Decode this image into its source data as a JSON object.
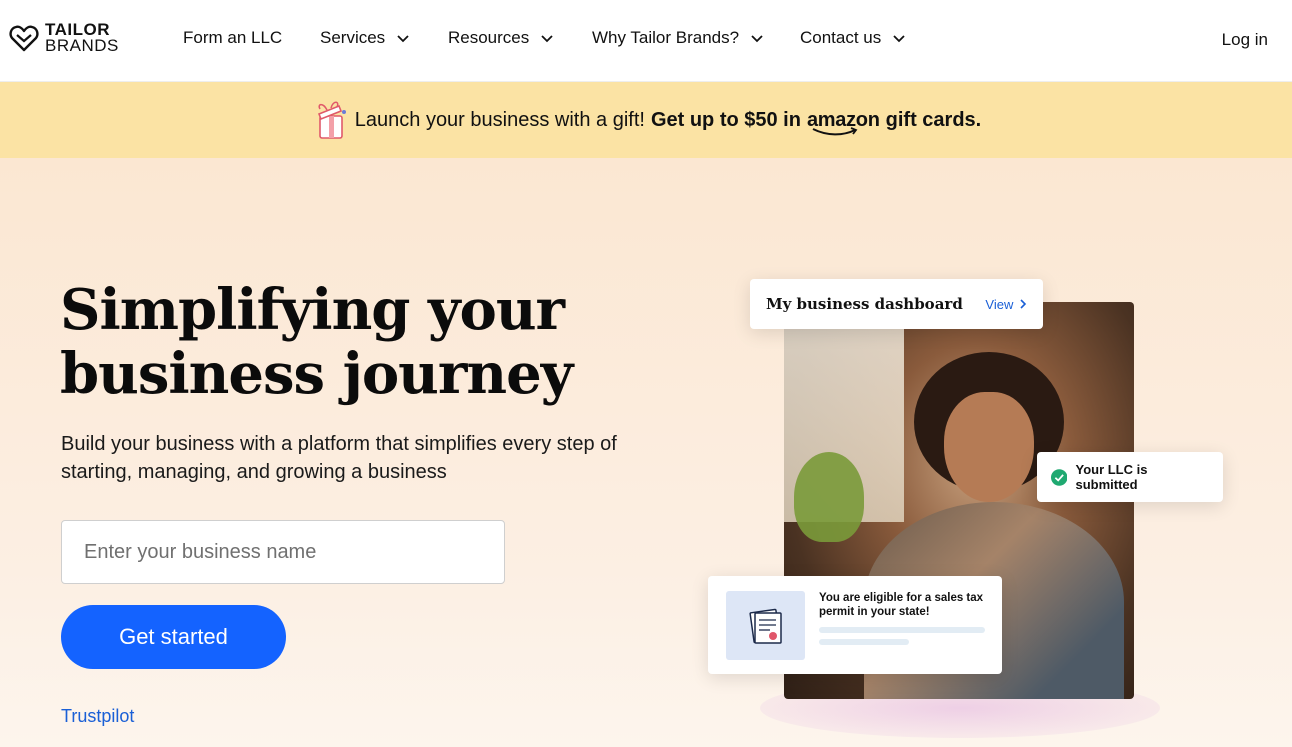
{
  "brand": {
    "line1": "TAILOR",
    "line2": "BRANDS"
  },
  "nav": {
    "items": [
      {
        "label": "Form an LLC",
        "has_dropdown": false
      },
      {
        "label": "Services",
        "has_dropdown": true
      },
      {
        "label": "Resources",
        "has_dropdown": true
      },
      {
        "label": "Why Tailor Brands?",
        "has_dropdown": true
      },
      {
        "label": "Contact us",
        "has_dropdown": true
      }
    ],
    "login": "Log in"
  },
  "promo": {
    "text": "Launch your business with a gift!",
    "bold_prefix": "Get up to $50 in",
    "amazon": "amazon",
    "bold_suffix": "gift cards.",
    "icon": "gift-icon",
    "background": "#fbe3a4"
  },
  "hero": {
    "title": "Simplifying your business journey",
    "subtitle": "Build your business with a platform that simplifies every step of starting, managing, and growing a business",
    "input_placeholder": "Enter your business name",
    "input_value": "",
    "cta": "Get started",
    "trust_link": "Trustpilot",
    "accent": "#1463ff"
  },
  "cards": {
    "dashboard_title": "My business dashboard",
    "dashboard_view": "View",
    "llc_status": "Your LLC is submitted",
    "tax_text": "You are eligible for a sales tax permit in your state!"
  }
}
